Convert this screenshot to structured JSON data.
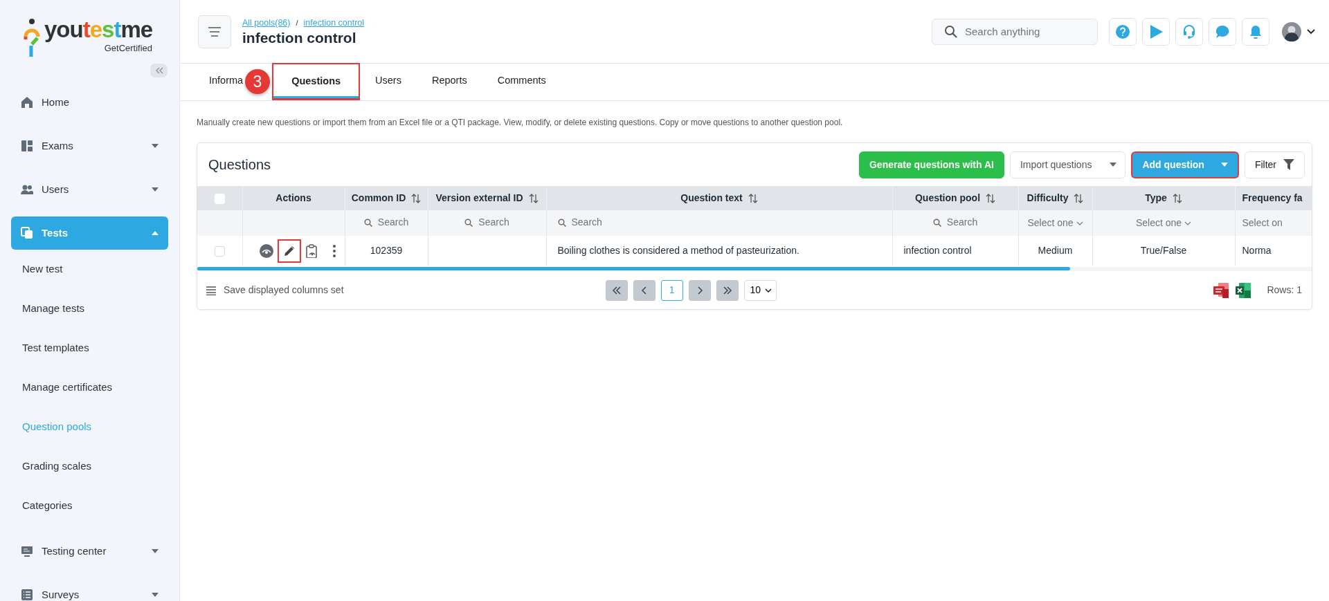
{
  "sidebar": {
    "logo": {
      "parts": [
        {
          "text": "you",
          "color": "#333333"
        },
        {
          "text": "t",
          "color": "#e8492c"
        },
        {
          "text": "e",
          "color": "#f5a623"
        },
        {
          "text": "s",
          "color": "#5bc236"
        },
        {
          "text": "t",
          "color": "#2ea8e0"
        },
        {
          "text": "me",
          "color": "#333333"
        }
      ],
      "tagline": "GetCertified"
    },
    "items": [
      {
        "label": "Home",
        "selected": false
      },
      {
        "label": "Exams",
        "selected": false,
        "expanded": false
      },
      {
        "label": "Users",
        "selected": false,
        "expanded": false
      },
      {
        "label": "Tests",
        "selected": true,
        "expanded": true,
        "children": [
          {
            "label": "New test",
            "selected": false
          },
          {
            "label": "Manage tests",
            "selected": false
          },
          {
            "label": "Test templates",
            "selected": false
          },
          {
            "label": "Manage certificates",
            "selected": false
          },
          {
            "label": "Question pools",
            "selected": true
          },
          {
            "label": "Grading scales",
            "selected": false
          },
          {
            "label": "Categories",
            "selected": false
          }
        ]
      },
      {
        "label": "Testing center",
        "selected": false,
        "expanded": false
      },
      {
        "label": "Surveys",
        "selected": false,
        "expanded": false
      }
    ]
  },
  "header": {
    "breadcrumbs": [
      "All pools(86)",
      "infection control"
    ],
    "separator": "/",
    "title": "infection control",
    "search": {
      "placeholder": "Search anything"
    }
  },
  "tabs": [
    {
      "label": "Informa",
      "selected": false,
      "highlighted": false
    },
    {
      "label": "Questions",
      "selected": true,
      "highlighted": true
    },
    {
      "label": "Users",
      "selected": false,
      "highlighted": false
    },
    {
      "label": "Reports",
      "selected": false,
      "highlighted": false
    },
    {
      "label": "Comments",
      "selected": false,
      "highlighted": false
    }
  ],
  "step_badge": "3",
  "description": "Manually create new questions or import them from an Excel file or a QTI package. View, modify, or delete existing questions. Copy or move questions to another question pool.",
  "card": {
    "title": "Questions",
    "buttons": [
      {
        "label": "Generate questions with AI",
        "kind": "success",
        "highlighted": false
      },
      {
        "label": "Import questions",
        "kind": "dropdown",
        "highlighted": false
      },
      {
        "label": "Add question",
        "kind": "primary-dropdown",
        "highlighted": true
      },
      {
        "label": "Filter",
        "kind": "filter",
        "highlighted": false
      }
    ],
    "table": {
      "header_checked": false,
      "actions_column": {
        "label": "Actions"
      },
      "columns": [
        {
          "label": "Common ID",
          "sortable": true,
          "filter": {
            "kind": "search",
            "placeholder": "Search"
          }
        },
        {
          "label": "Version external ID",
          "sortable": true,
          "filter": {
            "kind": "search",
            "placeholder": "Search"
          }
        },
        {
          "label": "Question text",
          "sortable": true,
          "filter": {
            "kind": "search",
            "placeholder": "Search"
          }
        },
        {
          "label": "Question pool",
          "sortable": true,
          "filter": {
            "kind": "search",
            "placeholder": "Search"
          }
        },
        {
          "label": "Difficulty",
          "sortable": true,
          "filter": {
            "kind": "select",
            "placeholder": "Select one"
          }
        },
        {
          "label": "Type",
          "sortable": true,
          "filter": {
            "kind": "select",
            "placeholder": "Select one"
          }
        },
        {
          "label": "Frequency fa",
          "sortable": false,
          "filter": {
            "kind": "select-cut",
            "placeholder": "Select on"
          }
        }
      ],
      "rows": [
        {
          "selected": false,
          "actions": [
            {
              "highlighted": false
            },
            {
              "highlighted": true
            },
            {
              "highlighted": false
            },
            {
              "highlighted": false
            }
          ],
          "cells": [
            "102359",
            "",
            "Boiling clothes is considered a method of pasteurization.",
            "infection control",
            "Medium",
            "True/False",
            "Norma"
          ]
        }
      ]
    },
    "footer": {
      "save_label": "Save displayed columns set",
      "pages": [
        {
          "label": "1",
          "selected": true
        }
      ],
      "page_size": "10",
      "rows_label": "Rows: 1"
    }
  }
}
